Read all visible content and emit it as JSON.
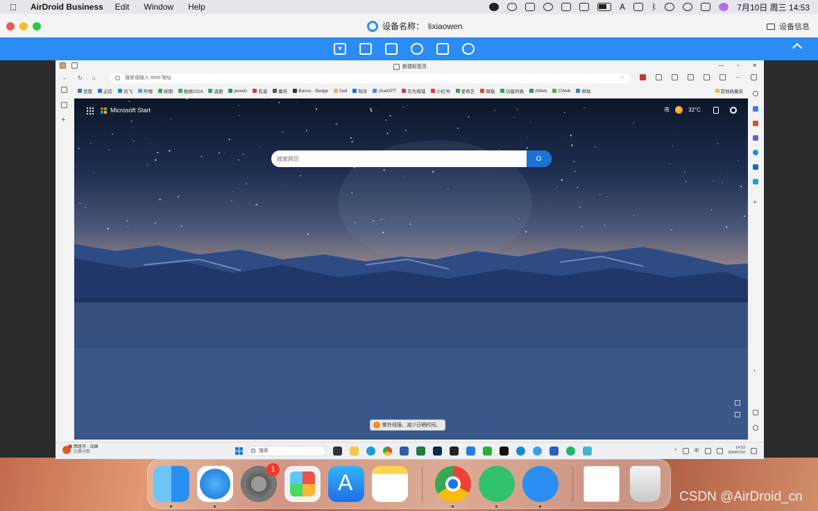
{
  "menubar": {
    "app_name": "AirDroid Business",
    "menus": [
      "Edit",
      "Window",
      "Help"
    ],
    "date_time": "7月10日 周三  14:53",
    "input_method": "A"
  },
  "window": {
    "title_label": "设备名称：",
    "device_name": "lixiaowen",
    "device_info_label": "设备信息"
  },
  "toolbar": {
    "icons": [
      "monitor-icon",
      "shield-icon",
      "message-icon",
      "phone-icon",
      "fullscreen-icon",
      "disconnect-icon"
    ]
  },
  "remote": {
    "edge": {
      "tab_title": "新建标签页",
      "address_placeholder": "搜索或输入 Web 地址",
      "bookmarks": [
        "百度",
        "必应",
        "讯飞",
        "哔哩",
        "排期",
        "数据2024",
        "选题",
        "pexels",
        "有道",
        "幕布",
        "Basno - Badge",
        "Dell",
        "知乎",
        "chatGPT",
        "华为商城",
        "小红书",
        "爱奇艺",
        "邮箱",
        "功能列表",
        "AWeb",
        "CWeb",
        "帮助"
      ],
      "other_favorites": "其他收藏夹"
    },
    "start_page": {
      "brand": "Microsoft Start",
      "weather_city": "市",
      "temperature": "32°C",
      "search_placeholder": "搜索网页",
      "toast": "紫外线强，减少日晒时间。"
    },
    "taskbar": {
      "weather_title": "西班牙 - 法国",
      "weather_sub": "比赛分数",
      "search_placeholder": "搜索",
      "ime": "中",
      "clock_time": "14:53",
      "clock_date": "2024/7/10"
    }
  },
  "dock": {
    "apps": [
      "finder",
      "safari",
      "system-settings",
      "launchpad",
      "app-store",
      "notes",
      "chrome",
      "airdroid-business",
      "airdroid-cast",
      "window-preview",
      "trash"
    ],
    "settings_badge": "1"
  },
  "watermark": "CSDN @AirDroid_cn"
}
